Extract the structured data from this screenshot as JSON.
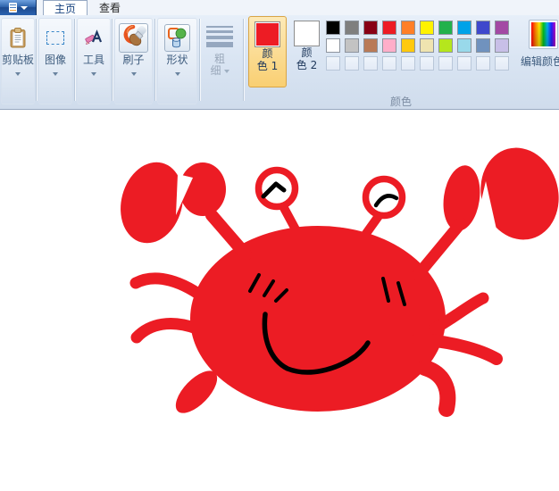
{
  "tab_bar": {
    "tabs": [
      {
        "label": "主页",
        "active": true
      },
      {
        "label": "查看",
        "active": false
      }
    ]
  },
  "ribbon": {
    "groups": {
      "clipboard": {
        "label": "剪贴板"
      },
      "image": {
        "label": "图像"
      },
      "tools": {
        "label": "工具"
      },
      "brushes": {
        "label": "刷子"
      },
      "shapes": {
        "label": "形状"
      },
      "size": {
        "label_line1": "粗",
        "label_line2": "细",
        "disabled": true
      }
    },
    "colors": {
      "group_label": "颜色",
      "color1": {
        "label_line1": "颜",
        "label_line2": "色 1",
        "value": "#ED1C24",
        "selected": true
      },
      "color2": {
        "label_line1": "颜",
        "label_line2": "色 2",
        "value": "#FFFFFF",
        "selected": false
      },
      "palette_row1": [
        "#000000",
        "#7F7F7F",
        "#880015",
        "#ED1C24",
        "#FF7F27",
        "#FFF200",
        "#22B14C",
        "#00A2E8",
        "#3F48CC",
        "#A349A4"
      ],
      "palette_row2": [
        "#FFFFFF",
        "#C3C3C3",
        "#B97A57",
        "#FFAEC9",
        "#FFC90E",
        "#EFE4B0",
        "#B5E61D",
        "#99D9EA",
        "#7092BE",
        "#C8BFE7"
      ],
      "palette_empty_slots": 10,
      "edit_colors_label": "编辑颜色"
    }
  },
  "canvas": {
    "background": "#FFFFFF",
    "drawing": {
      "subject": "crab",
      "body_color": "#EC1C24",
      "ink_color": "#000000",
      "eye_white": "#FFFFFF"
    }
  }
}
